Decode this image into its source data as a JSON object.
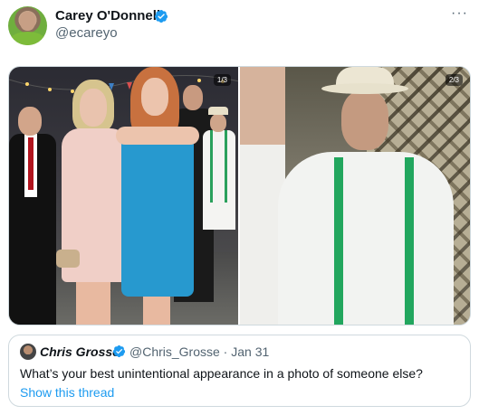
{
  "tweet": {
    "author_name": "Carey O'Donnell",
    "author_handle": "@ecareyo",
    "more_icon": "more-dots-icon",
    "verified_icon": "verified-badge-icon"
  },
  "media": {
    "photos": [
      {
        "counter": "1/3"
      },
      {
        "counter": "2/3"
      }
    ]
  },
  "quote": {
    "author_name": "Chris Grosse",
    "author_handle_date": "@Chris_Grosse · Jan 31",
    "text": "What’s your best unintentional appearance in a photo of someone else?",
    "show_thread": "Show this thread"
  },
  "colors": {
    "accent": "#1d9bf0",
    "secondary_text": "#536471",
    "border": "#cfd9de"
  }
}
